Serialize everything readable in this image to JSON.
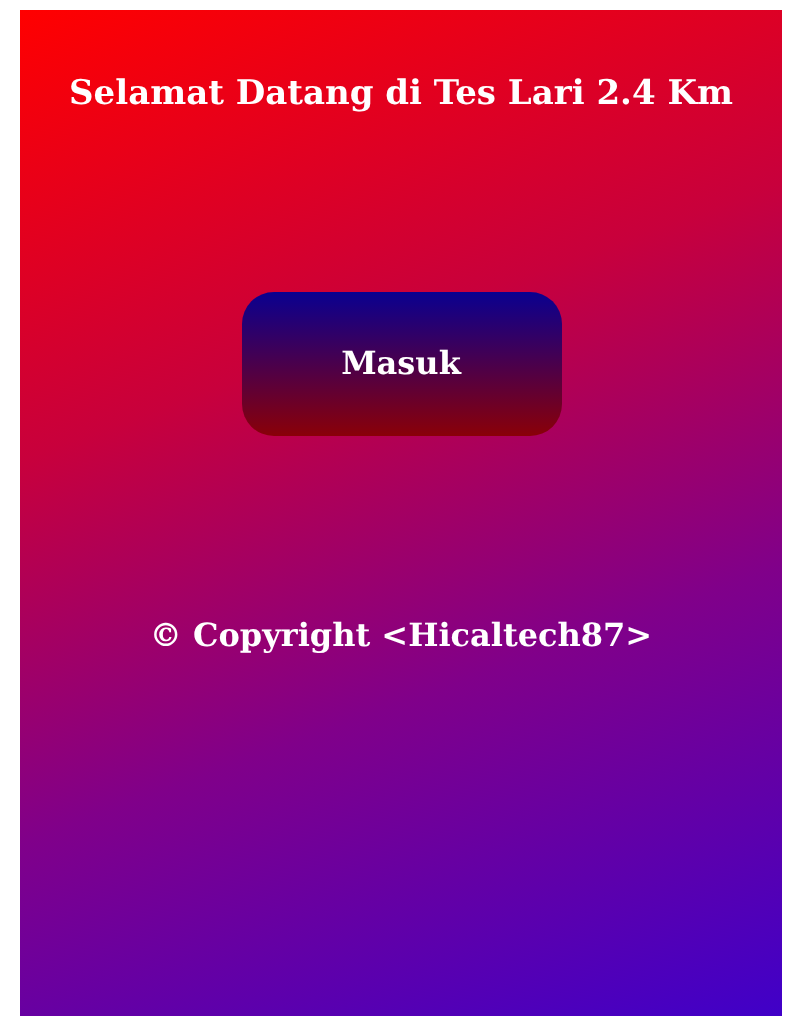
{
  "title": "Selamat Datang di Tes Lari 2.4 Km",
  "login_button": {
    "label": "Masuk"
  },
  "footer": "© Copyright <Hicaltech87>"
}
